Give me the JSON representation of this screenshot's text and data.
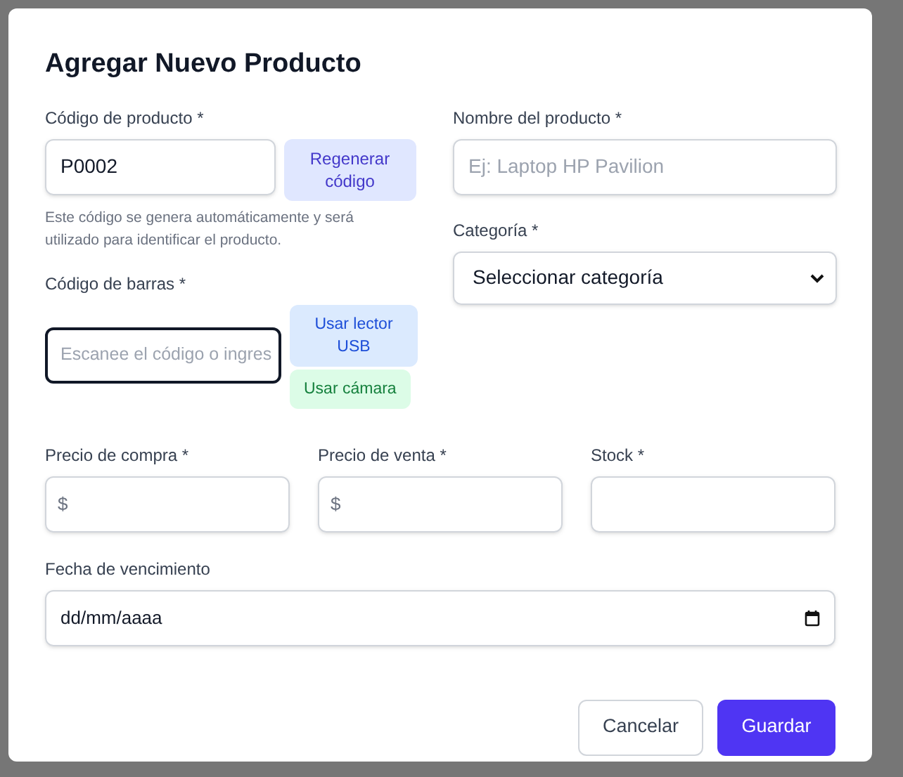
{
  "dialog": {
    "title": "Agregar Nuevo Producto"
  },
  "product_code": {
    "label": "Código de producto *",
    "value": "P0002",
    "button": "Regenerar código",
    "help": "Este código se genera automáticamente y será utilizado para identificar el producto."
  },
  "product_name": {
    "label": "Nombre del producto *",
    "placeholder": "Ej: Laptop HP Pavilion"
  },
  "category": {
    "label": "Categoría *",
    "value": "Seleccionar categoría"
  },
  "barcode": {
    "label": "Código de barras *",
    "placeholder": "Escanee el código o ingres",
    "focused": true,
    "buttons": [
      {
        "label": "Usar lector USB",
        "kind": "usb"
      },
      {
        "label": "Usar cámara",
        "kind": "camera"
      }
    ]
  },
  "price_fields": [
    {
      "label": "Precio de compra *",
      "prefix": "$"
    },
    {
      "label": "Precio de venta *",
      "prefix": "$"
    },
    {
      "label": "Stock *"
    }
  ],
  "expiry_date": {
    "label": "Fecha de vencimiento",
    "value": "dd/mm/aaaa"
  },
  "actions": [
    {
      "label": "Cancelar",
      "kind": "secondary"
    },
    {
      "label": "Guardar",
      "kind": "primary"
    }
  ]
}
